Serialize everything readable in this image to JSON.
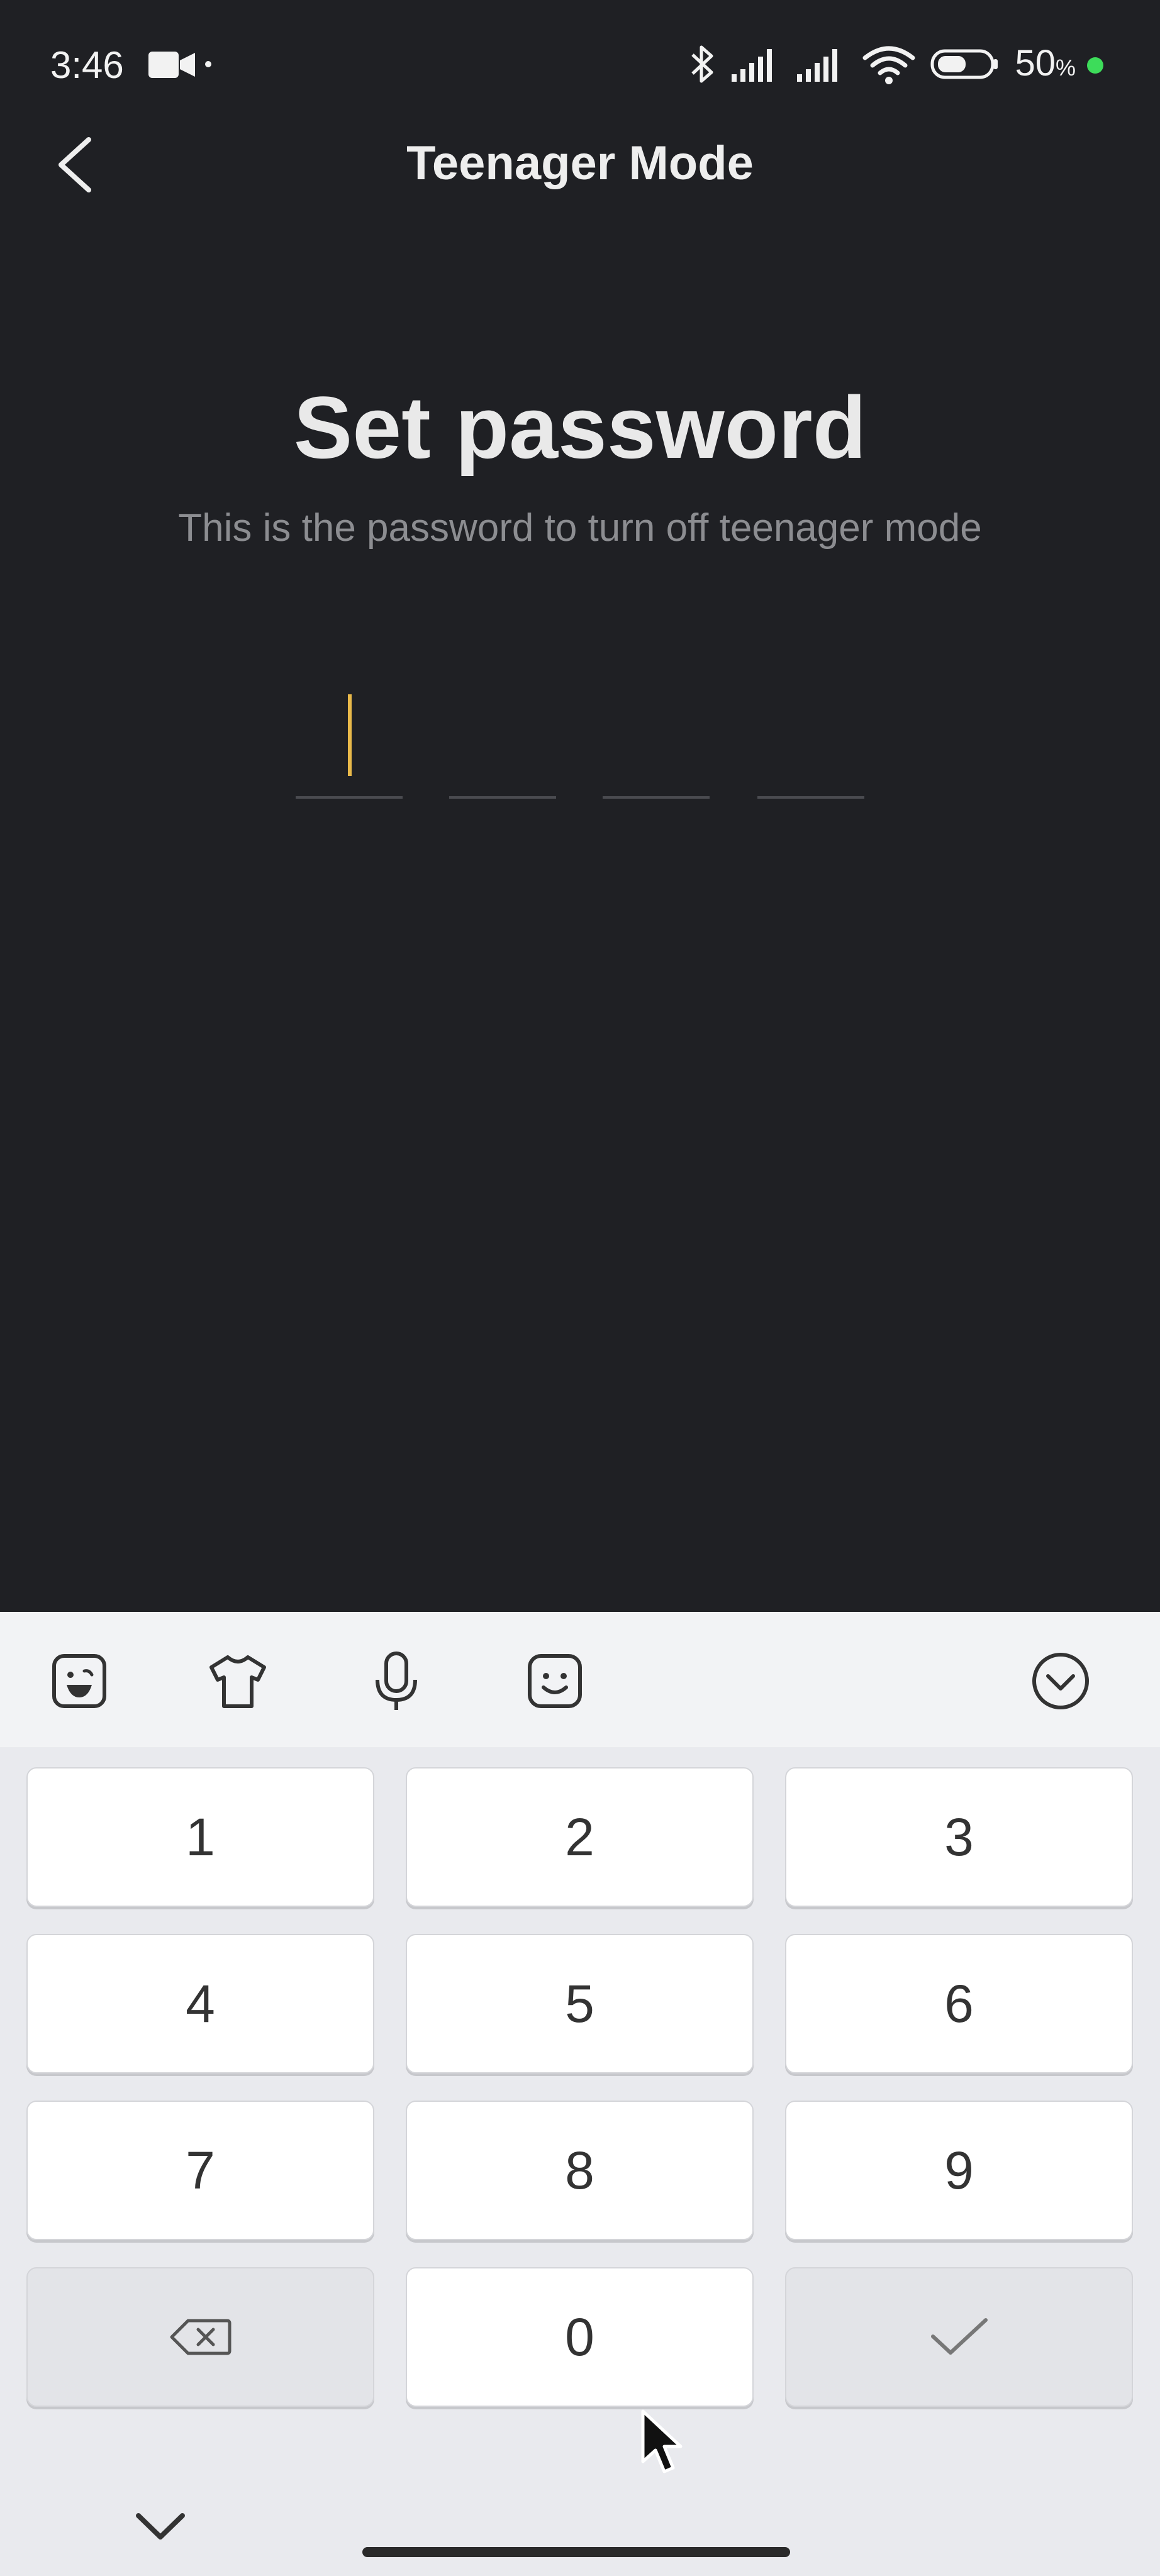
{
  "status_bar": {
    "time": "3:46",
    "battery_percent": "50",
    "battery_suffix": "%"
  },
  "header": {
    "title": "Teenager Mode"
  },
  "main": {
    "title": "Set password",
    "subtitle": "This is the password to turn off teenager mode",
    "pin_length": 4,
    "pin_digits": [
      "",
      "",
      "",
      ""
    ]
  },
  "keyboard": {
    "keys": [
      "1",
      "2",
      "3",
      "4",
      "5",
      "6",
      "7",
      "8",
      "9",
      "0"
    ]
  },
  "colors": {
    "background": "#1f2024",
    "cursor": "#e9b94a",
    "charging_dot": "#3ddc5a",
    "keyboard_bg": "#e9eaee"
  }
}
